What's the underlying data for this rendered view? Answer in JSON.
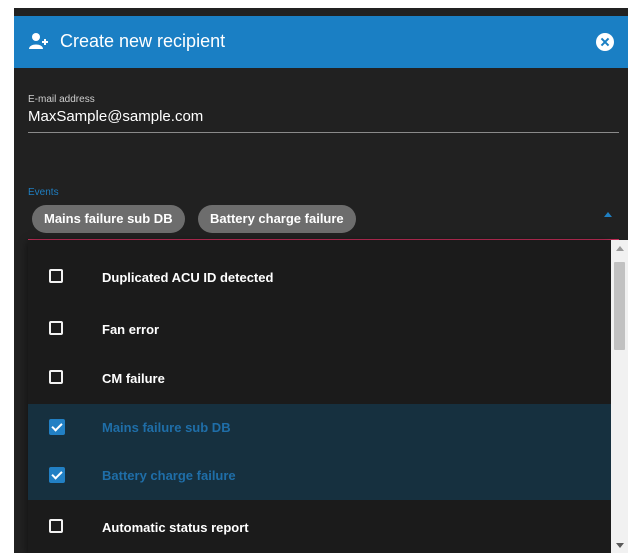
{
  "dialog": {
    "title": "Create new recipient",
    "header_color": "#1a7fc4",
    "icons": {
      "title": "user-add-icon",
      "close": "close-icon"
    }
  },
  "email": {
    "label": "E-mail address",
    "value": "MaxSample@sample.com"
  },
  "events": {
    "label": "Events",
    "selected_chips": [
      "Mains failure sub DB",
      "Battery charge failure"
    ],
    "dropdown_open": true
  },
  "options": [
    {
      "label": "Duplicated ACU ID detected",
      "checked": false
    },
    {
      "label": "Fan error",
      "checked": false
    },
    {
      "label": "CM failure",
      "checked": false
    },
    {
      "label": "Mains failure sub DB",
      "checked": true
    },
    {
      "label": "Battery charge failure",
      "checked": true
    },
    {
      "label": "Automatic status report",
      "checked": false
    }
  ],
  "colors": {
    "accent": "#1f7fc2",
    "background": "#212121",
    "selected_row": "#16303f",
    "focus_line": "#c62f5a"
  }
}
